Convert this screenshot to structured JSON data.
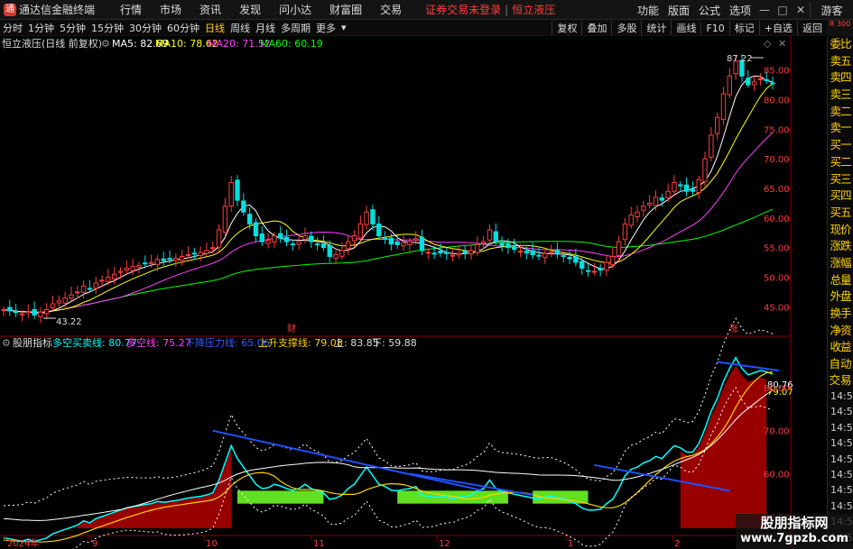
{
  "titlebar": {
    "app_title": "通达信金融终端",
    "menu": [
      "行情",
      "市场",
      "资讯",
      "发现",
      "问小达",
      "财富圈",
      "交易"
    ],
    "security_login": "证券交易未登录",
    "separator": "|",
    "stock_name": "恒立液压",
    "right_menu": [
      "功能",
      "版面",
      "公式",
      "选项"
    ],
    "guest": "游客"
  },
  "toolbar": {
    "periods": [
      "分时",
      "1分钟",
      "5分钟",
      "15分钟",
      "30分钟",
      "60分钟",
      "日线",
      "周线",
      "月线",
      "多周期",
      "更多"
    ],
    "active_period": "日线",
    "buttons": [
      "复权",
      "叠加",
      "多股",
      "统计",
      "画线",
      "F10",
      "标记",
      "+自选",
      "返回"
    ]
  },
  "main_chart": {
    "title": "恒立液压(日线 前复权)",
    "ma5": "MA5: 82.69",
    "ma10": "MA10: 78.62",
    "ma20": "MA20: 71.52",
    "ma60": "MA60: 60.19",
    "high_label": "87.22",
    "low_label": "43.22",
    "event_cai": "财",
    "event_zhang": "涨",
    "y_ticks": [
      "85.00",
      "80.00",
      "75.00",
      "70.00",
      "65.00",
      "60.00",
      "55.00",
      "50.00",
      "45.00"
    ]
  },
  "indicator": {
    "name": "股朋指标",
    "l1": "多空买卖线: 80.77",
    "l2": "多空线: 75.27",
    "l3": "下降压力线: 65.06",
    "l4": "上升支撑线: 79.08",
    "l5": "上: 83.85",
    "l6": "下: 59.88",
    "val_a": "80.76",
    "val_b": "79.07",
    "y_ticks": [
      "80.00",
      "70.00",
      "60.00",
      "50.00"
    ]
  },
  "x_axis": [
    "2024年",
    "9",
    "10",
    "11",
    "12",
    "1",
    "2"
  ],
  "side_tabs": [
    "委比",
    "卖五",
    "卖四",
    "卖三",
    "卖二",
    "卖一",
    "买一",
    "买二",
    "买三",
    "买四",
    "买五",
    "现价",
    "涨跌",
    "涨幅",
    "总量",
    "外盘",
    "换手",
    "净资",
    "收益"
  ],
  "side_top": "R 300",
  "side_bottom_tabs": [
    "自动",
    "交易"
  ],
  "tick_times": [
    "14:56",
    "14:56",
    "14:56",
    "14:56",
    "14:56",
    "14:56",
    "14:56",
    "14:56",
    "14:56",
    "14:56",
    "14:56"
  ],
  "watermark": {
    "line1": "股朋指标网",
    "line2": "www.7gpzb.com"
  },
  "colors": {
    "up": "#ff3c3c",
    "down": "#00e0e0",
    "ma5": "#ffffff",
    "ma10": "#ffff00",
    "ma20": "#ff40ff",
    "ma60": "#00ff00"
  },
  "chart_data": {
    "type": "candlestick",
    "dates_axis_labels": [
      "2024年",
      "9",
      "10",
      "11",
      "12",
      "1",
      "2"
    ],
    "ylim": [
      42,
      88
    ],
    "closes": [
      44.5,
      44.3,
      44,
      43.8,
      44.2,
      43.6,
      44.1,
      44.5,
      45.5,
      46,
      46.5,
      47,
      47.5,
      48.5,
      48,
      49,
      49.5,
      50,
      50.5,
      51,
      51.5,
      51.8,
      52,
      52.3,
      52.5,
      53,
      52.8,
      53,
      53.2,
      53.5,
      53.8,
      54,
      54.2,
      54.5,
      55,
      58,
      62,
      66,
      63,
      61,
      59,
      57,
      56,
      56.2,
      57,
      56.6,
      56,
      55.6,
      56,
      57,
      56,
      55.5,
      55,
      53.5,
      53.8,
      54.5,
      56,
      57,
      59,
      61,
      59,
      57,
      56.5,
      55.6,
      55.5,
      55.8,
      56,
      56.5,
      54.5,
      54.2,
      54,
      54.1,
      54,
      53.7,
      54,
      54.1,
      54.5,
      55.5,
      56,
      58,
      56,
      55.3,
      55,
      54.7,
      54.4,
      54.1,
      53.8,
      53.7,
      54,
      54.2,
      53.9,
      53.6,
      53.1,
      52.5,
      51.5,
      51,
      51,
      51.2,
      52.5,
      53.5,
      56,
      59,
      60.5,
      61,
      62,
      62.5,
      63.5,
      63,
      64.5,
      66,
      65.5,
      64.5,
      64.5,
      66.5,
      70,
      74,
      77,
      81,
      84,
      86.5,
      84,
      82.5,
      83,
      83.5,
      83.2,
      82.7
    ],
    "ma5": 82.69,
    "ma10": 78.62,
    "ma20": 71.52,
    "ma60": 60.19,
    "high": 87.22,
    "low": 43.22
  }
}
